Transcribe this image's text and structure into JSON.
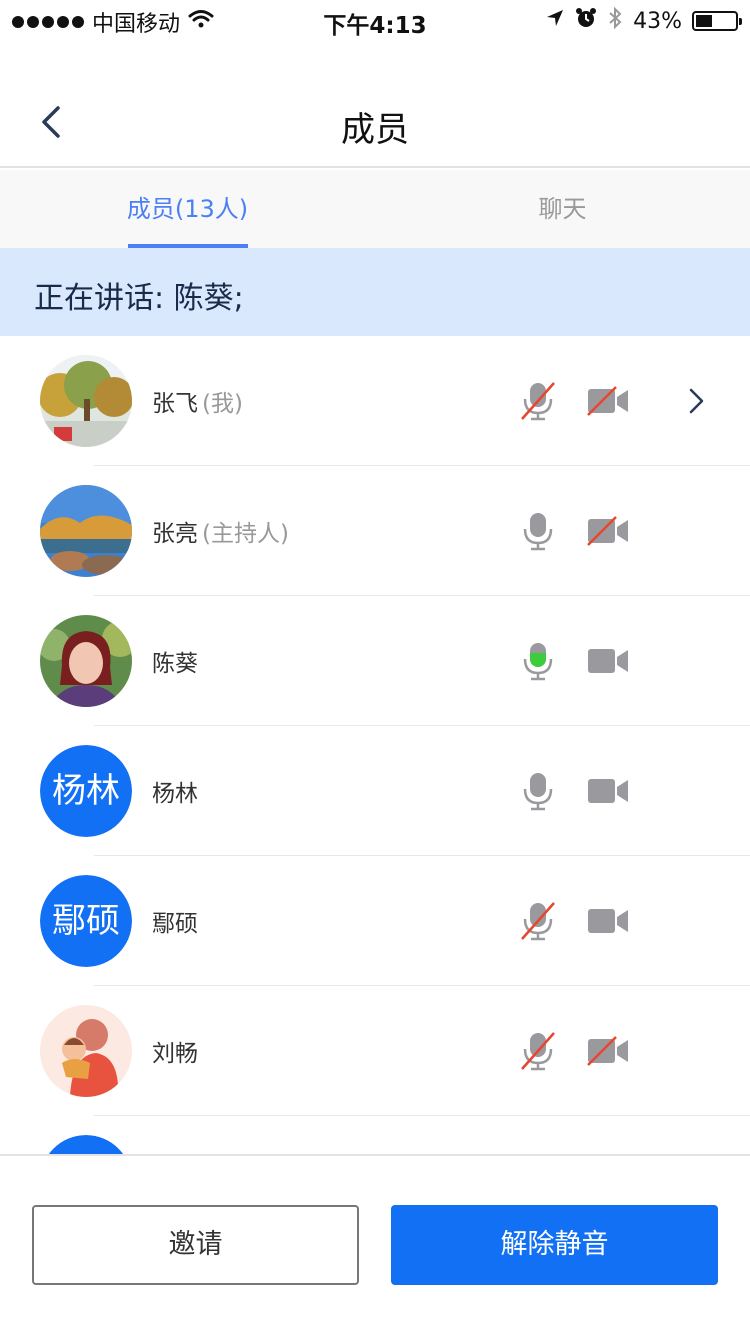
{
  "status_bar": {
    "carrier": "中国移动",
    "time": "下午4:13",
    "battery_text": "43%",
    "battery_level": 0.43
  },
  "nav": {
    "title": "成员"
  },
  "tabs": [
    {
      "label": "成员(13人)",
      "active": true
    },
    {
      "label": "聊天",
      "active": false
    }
  ],
  "banner": {
    "text": "正在讲话: 陈葵;"
  },
  "members": [
    {
      "name": "张飞",
      "role": "(我)",
      "avatar": "photo-trees",
      "avatar_text": "",
      "mic": "muted",
      "camera": "off",
      "has_chevron": true
    },
    {
      "name": "张亮",
      "role": "(主持人)",
      "avatar": "photo-river",
      "avatar_text": "",
      "mic": "on",
      "camera": "off",
      "has_chevron": false
    },
    {
      "name": "陈葵",
      "role": "",
      "avatar": "photo-woman",
      "avatar_text": "",
      "mic": "speaking",
      "camera": "on",
      "has_chevron": false
    },
    {
      "name": "杨林",
      "role": "",
      "avatar": "text",
      "avatar_text": "杨林",
      "mic": "on",
      "camera": "on",
      "has_chevron": false
    },
    {
      "name": "鄢硕",
      "role": "",
      "avatar": "text",
      "avatar_text": "鄢硕",
      "mic": "muted",
      "camera": "on",
      "has_chevron": false
    },
    {
      "name": "刘畅",
      "role": "",
      "avatar": "photo-cartoon",
      "avatar_text": "",
      "mic": "muted",
      "camera": "off",
      "has_chevron": false
    },
    {
      "name": "",
      "role": "",
      "avatar": "text",
      "avatar_text": "",
      "mic": "",
      "camera": "",
      "has_chevron": false
    }
  ],
  "buttons": {
    "invite": "邀请",
    "unmute": "解除静音"
  },
  "colors": {
    "accent": "#1270f4",
    "tab_active": "#4a7ff5",
    "banner_bg": "#d9e8fd",
    "speaking": "#3ccc3c",
    "muted_slash": "#e8452f",
    "icon_gray": "#9a9a9e"
  }
}
